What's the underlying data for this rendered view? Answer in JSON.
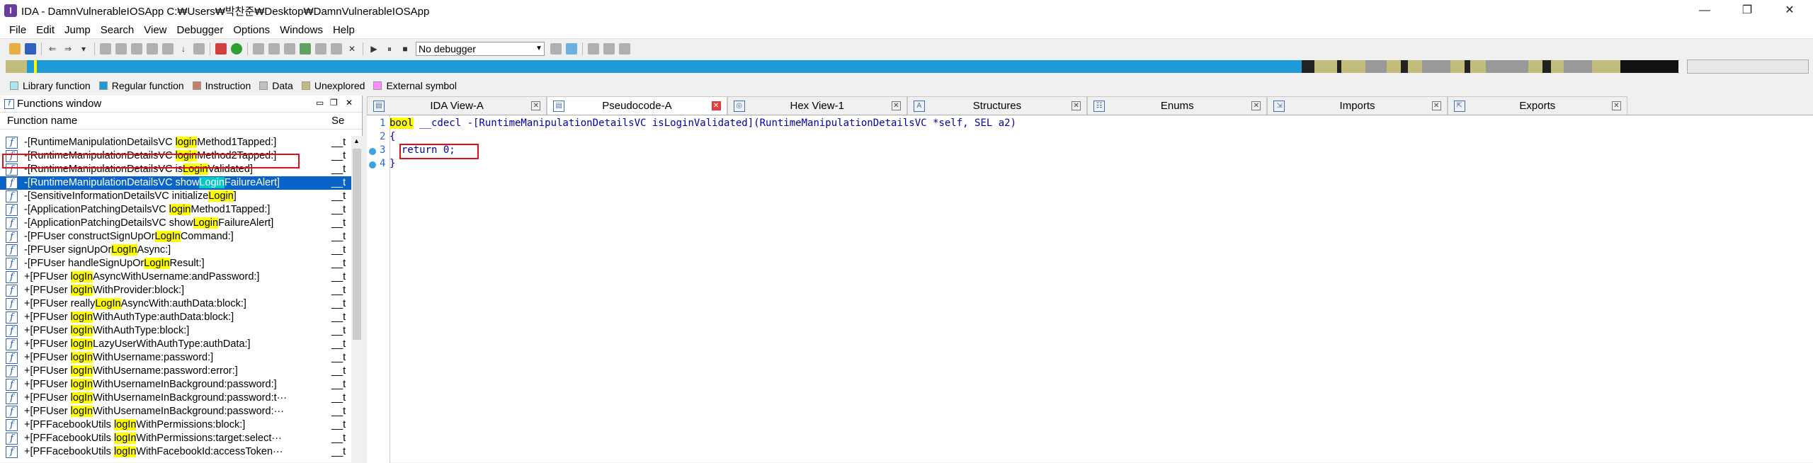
{
  "window": {
    "title": "IDA - DamnVulnerableIOSApp C:₩Users₩박찬준₩Desktop₩DamnVulnerableIOSApp",
    "controls": [
      "—",
      "❐",
      "✕"
    ]
  },
  "menu": [
    "File",
    "Edit",
    "Jump",
    "Search",
    "View",
    "Debugger",
    "Options",
    "Windows",
    "Help"
  ],
  "toolbar": {
    "debugger_select": "No debugger"
  },
  "legend": [
    {
      "label": "Library function",
      "color": "#a9e4ef"
    },
    {
      "label": "Regular function",
      "color": "#1e9bd6"
    },
    {
      "label": "Instruction",
      "color": "#c0806a"
    },
    {
      "label": "Data",
      "color": "#c0c0c0"
    },
    {
      "label": "Unexplored",
      "color": "#c3bd7c"
    },
    {
      "label": "External symbol",
      "color": "#ff8cff"
    }
  ],
  "functions_window": {
    "title": "Functions window",
    "col_name": "Function name",
    "col_segment": "Se",
    "rows": [
      {
        "pre": "-[RuntimeManipulationDetailsVC ",
        "hl": "login",
        "post": "Method1Tapped:]",
        "seg": "__t"
      },
      {
        "pre": "-[RuntimeManipulationDetailsVC ",
        "hl": "login",
        "post": "Method2Tapped:]",
        "seg": "__t"
      },
      {
        "pre": "-[RuntimeManipulationDetailsVC is",
        "hl": "Login",
        "post": "Validated]",
        "seg": "__t"
      },
      {
        "pre": "-[RuntimeManipulationDetailsVC show",
        "hl": "Login",
        "post": "FailureAlert]",
        "seg": "__t"
      },
      {
        "pre": "-[SensitiveInformationDetailsVC initialize",
        "hl": "Login",
        "post": "]",
        "seg": "__t"
      },
      {
        "pre": "-[ApplicationPatchingDetailsVC ",
        "hl": "login",
        "post": "Method1Tapped:]",
        "seg": "__t"
      },
      {
        "pre": "-[ApplicationPatchingDetailsVC show",
        "hl": "Login",
        "post": "FailureAlert]",
        "seg": "__t"
      },
      {
        "pre": "-[PFUser constructSignUpOr",
        "hl": "LogIn",
        "post": "Command:]",
        "seg": "__t"
      },
      {
        "pre": "-[PFUser signUpOr",
        "hl": "LogIn",
        "post": "Async:]",
        "seg": "__t"
      },
      {
        "pre": "-[PFUser handleSignUpOr",
        "hl": "LogIn",
        "post": "Result:]",
        "seg": "__t"
      },
      {
        "pre": "+[PFUser ",
        "hl": "logIn",
        "post": "AsyncWithUsername:andPassword:]",
        "seg": "__t"
      },
      {
        "pre": "+[PFUser ",
        "hl": "logIn",
        "post": "WithProvider:block:]",
        "seg": "__t"
      },
      {
        "pre": "+[PFUser really",
        "hl": "LogIn",
        "post": "AsyncWith:authData:block:]",
        "seg": "__t"
      },
      {
        "pre": "+[PFUser ",
        "hl": "logIn",
        "post": "WithAuthType:authData:block:]",
        "seg": "__t"
      },
      {
        "pre": "+[PFUser ",
        "hl": "logIn",
        "post": "WithAuthType:block:]",
        "seg": "__t"
      },
      {
        "pre": "+[PFUser ",
        "hl": "logIn",
        "post": "LazyUserWithAuthType:authData:]",
        "seg": "__t"
      },
      {
        "pre": "+[PFUser ",
        "hl": "logIn",
        "post": "WithUsername:password:]",
        "seg": "__t"
      },
      {
        "pre": "+[PFUser ",
        "hl": "logIn",
        "post": "WithUsername:password:error:]",
        "seg": "__t"
      },
      {
        "pre": "+[PFUser ",
        "hl": "logIn",
        "post": "WithUsernameInBackground:password:]",
        "seg": "__t"
      },
      {
        "pre": "+[PFUser ",
        "hl": "logIn",
        "post": "WithUsernameInBackground:password:t···",
        "seg": "__t"
      },
      {
        "pre": "+[PFUser ",
        "hl": "logIn",
        "post": "WithUsernameInBackground:password:···",
        "seg": "__t"
      },
      {
        "pre": "+[PFFacebookUtils ",
        "hl": "logIn",
        "post": "WithPermissions:block:]",
        "seg": "__t"
      },
      {
        "pre": "+[PFFacebookUtils ",
        "hl": "logIn",
        "post": "WithPermissions:target:select···",
        "seg": "__t"
      },
      {
        "pre": "+[PFFacebookUtils ",
        "hl": "logIn",
        "post": "WithFacebookId:accessToken···",
        "seg": "__t"
      }
    ]
  },
  "tabs": [
    {
      "label": "IDA View-A",
      "icon": "IDA",
      "active": false
    },
    {
      "label": "Pseudocode-A",
      "icon": "P",
      "active": true
    },
    {
      "label": "Hex View-1",
      "icon": "H",
      "active": false
    },
    {
      "label": "Structures",
      "icon": "A",
      "active": false
    },
    {
      "label": "Enums",
      "icon": "E",
      "active": false
    },
    {
      "label": "Imports",
      "icon": "I",
      "active": false
    },
    {
      "label": "Exports",
      "icon": "X",
      "active": false
    }
  ],
  "pseudocode": {
    "lines": [
      {
        "num": "1",
        "kw": "bool",
        "text": " __cdecl -[RuntimeManipulationDetailsVC isLoginValidated](RuntimeManipulationDetailsVC *self, SEL a2)",
        "dot": false
      },
      {
        "num": "2",
        "kw": "",
        "text": "{",
        "dot": false
      },
      {
        "num": "3",
        "kw": "",
        "text": "  return 0;",
        "dot": true
      },
      {
        "num": "4",
        "kw": "",
        "text": "}",
        "dot": true
      }
    ]
  }
}
